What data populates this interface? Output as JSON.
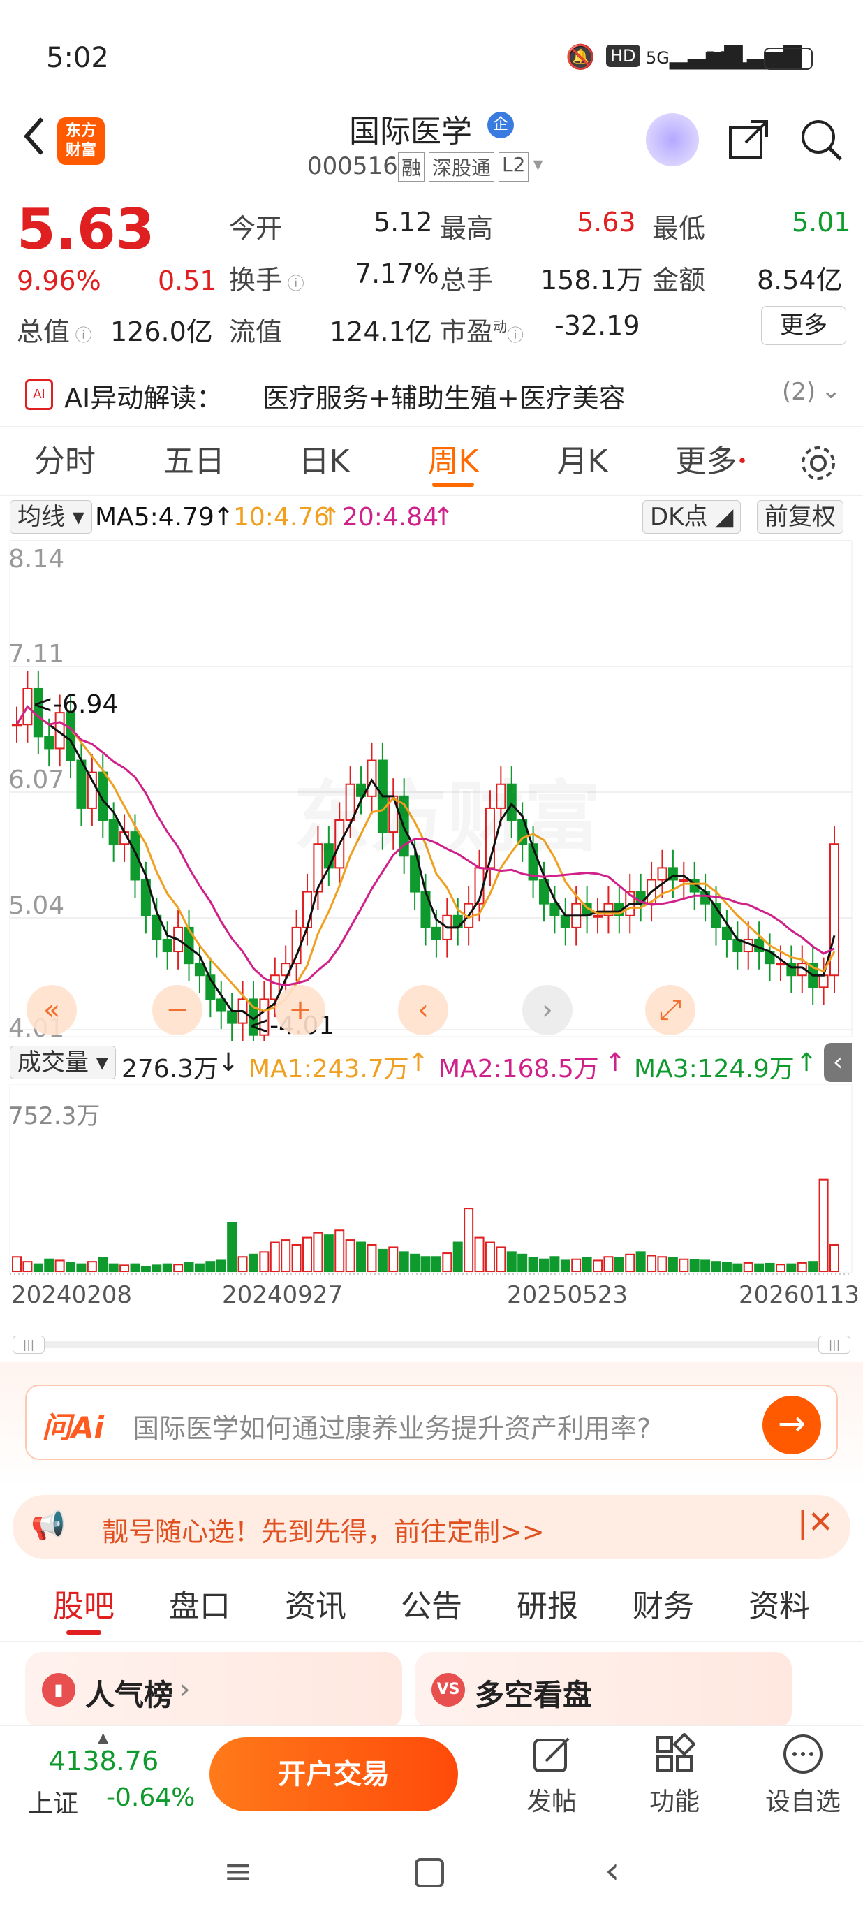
{
  "status": {
    "time": "5:02",
    "hd": "HD",
    "net1": "5G",
    "net2": "5G",
    "battery": "65"
  },
  "header": {
    "logo_top": "东方",
    "logo_bottom": "财富",
    "title": "国际医学",
    "title_badge": "企",
    "code": "000516",
    "tags": [
      "融",
      "深股通",
      "L2"
    ]
  },
  "quote": {
    "price": "5.63",
    "change_pct": "9.96%",
    "change": "0.51",
    "open_label": "今开",
    "open": "5.12",
    "high_label": "最高",
    "high": "5.63",
    "low_label": "最低",
    "low": "5.01",
    "turnover_label": "换手",
    "turnover": "7.17%",
    "volume_label": "总手",
    "volume": "158.1万",
    "amount_label": "金额",
    "amount": "8.54亿",
    "mcap_label": "总值",
    "mcap": "126.0亿",
    "float_label": "流值",
    "float": "124.1亿",
    "pe_label": "市盈",
    "pe_sup": "动",
    "pe": "-32.19",
    "more": "更多"
  },
  "ai": {
    "label": "AI异动解读：",
    "text": "医疗服务+辅助生殖+医疗美容",
    "count": "(2)"
  },
  "chart_tabs": [
    "分时",
    "五日",
    "日K",
    "周K",
    "月K",
    "更多"
  ],
  "ma": {
    "type": "均线",
    "ma5": "MA5:4.79",
    "ma10": "10:4.76",
    "ma20": "20:4.84",
    "dk": "DK点",
    "adj": "前复权"
  },
  "kline_axis": {
    "y1": "8.14",
    "y2": "7.11",
    "y3": "6.07",
    "y4": "5.04",
    "y5": "4.01",
    "marker_high": "<-6.94",
    "marker_low": "<-4.01",
    "watermark": "东方财富"
  },
  "vol": {
    "type": "成交量",
    "value": "276.3万",
    "ma1": "MA1:243.7万",
    "ma2": "MA2:168.5万",
    "ma3": "MA3:124.9万",
    "ymax": "752.3万",
    "dates": [
      "20240208",
      "20240927",
      "20250523",
      "20260113"
    ]
  },
  "ask": {
    "brand": "问Ai",
    "text": "国际医学如何通过康养业务提升资产利用率?"
  },
  "promo": {
    "text": "靓号随心选！先到先得，前往定制>>"
  },
  "bottom_tabs": [
    "股吧",
    "盘口",
    "资讯",
    "公告",
    "研报",
    "财务",
    "资料"
  ],
  "cards": [
    {
      "label": "人气榜"
    },
    {
      "label": "多空看盘"
    }
  ],
  "footer": {
    "index": "4138.76",
    "index_name": "上证",
    "index_chg": "-0.64%",
    "trade": "开户交易",
    "post": "发帖",
    "func": "功能",
    "fav": "设自选"
  },
  "colors": {
    "up": "#e02020",
    "down": "#0f9a2e",
    "accent": "#ff6a00",
    "ma5": "#111111",
    "ma10": "#f0a020",
    "ma20": "#d0208a"
  }
}
